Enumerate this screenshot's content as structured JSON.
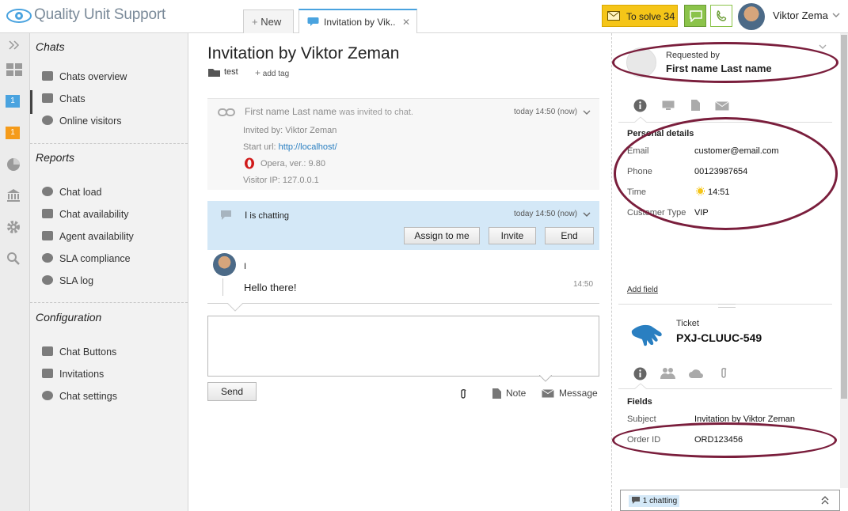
{
  "app": {
    "logo_text": "Quality Unit Support"
  },
  "tabs": [
    {
      "label": "New",
      "prefix": "+"
    },
    {
      "label": "Invitation by Vik..",
      "close": "✕"
    }
  ],
  "top_right": {
    "to_solve_label": "To solve",
    "to_solve_count": "34",
    "user_name": "Viktor Zema"
  },
  "left_rail": {
    "badge1": "1",
    "badge2": "1"
  },
  "sidebar": {
    "chats_title": "Chats",
    "chats_items": [
      "Chats overview",
      "Chats",
      "Online visitors"
    ],
    "reports_title": "Reports",
    "reports_items": [
      "Chat load",
      "Chat availability",
      "Agent availability",
      "SLA compliance",
      "SLA log"
    ],
    "config_title": "Configuration",
    "config_items": [
      "Chat Buttons",
      "Invitations",
      "Chat settings"
    ]
  },
  "main": {
    "title": "Invitation by Viktor Zeman",
    "tag": "test",
    "add_tag": "add tag",
    "event": {
      "name": "First name Last name",
      "action": "was invited to chat.",
      "time": "today 14:50 (now)",
      "invited_by": "Invited by: Viktor Zeman",
      "start_url_label": "Start url:",
      "start_url": "http://localhost/",
      "browser": "Opera, ver.: 9.80",
      "visitor_ip": "Visitor IP: 127.0.0.1"
    },
    "chatting": {
      "who": "I",
      "status": "is chatting",
      "time": "today 14:50 (now)",
      "assign_label": "Assign to me",
      "invite_label": "Invite",
      "end_label": "End"
    },
    "message": {
      "author": "I",
      "text": "Hello there!",
      "time": "14:50"
    },
    "composer": {
      "send_label": "Send",
      "note_label": "Note",
      "message_label": "Message"
    }
  },
  "right": {
    "requested_by_label": "Requested by",
    "requester_name": "First name Last name",
    "personal_details_title": "Personal details",
    "personal_details": [
      {
        "label": "Email",
        "value": "customer@email.com"
      },
      {
        "label": "Phone",
        "value": "00123987654"
      },
      {
        "label": "Time",
        "value": "14:51"
      },
      {
        "label": "Customer Type",
        "value": "VIP"
      }
    ],
    "add_field": "Add field",
    "ticket_label": "Ticket",
    "ticket_id": "PXJ-CLUUC-549",
    "fields_title": "Fields",
    "fields": [
      {
        "label": "Subject",
        "value": "Invitation by Viktor Zeman"
      },
      {
        "label": "Order ID",
        "value": "ORD123456"
      }
    ],
    "chatting_badge": "1 chatting"
  },
  "colors": {
    "accent": "#4aa3df",
    "annotation_oval": "#7a1e3c",
    "to_solve_bg": "#f5c518",
    "chatting_bg": "#d4e8f7"
  }
}
